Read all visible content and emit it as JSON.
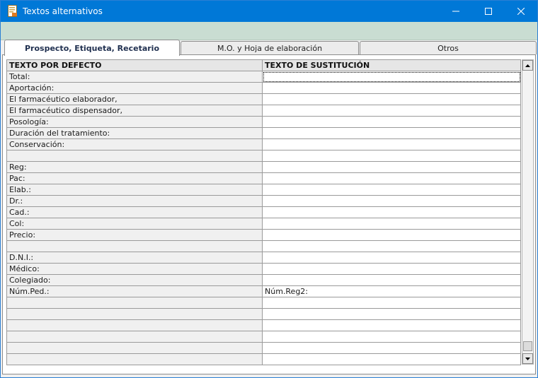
{
  "window": {
    "title": "Textos alternativos"
  },
  "tabs": [
    {
      "label": "Prospecto, Etiqueta, Recetario",
      "active": true
    },
    {
      "label": "M.O. y Hoja de elaboración",
      "active": false
    },
    {
      "label": "Otros",
      "active": false
    }
  ],
  "grid": {
    "headers": [
      "TEXTO POR DEFECTO",
      "TEXTO DE SUSTITUCIÓN"
    ],
    "rows": [
      [
        "Total:",
        ""
      ],
      [
        "Aportación:",
        ""
      ],
      [
        "El farmacéutico elaborador,",
        ""
      ],
      [
        "El farmacéutico dispensador,",
        ""
      ],
      [
        "Posología:",
        ""
      ],
      [
        "Duración del tratamiento:",
        ""
      ],
      [
        "Conservación:",
        ""
      ],
      [
        "",
        ""
      ],
      [
        "Reg:",
        ""
      ],
      [
        "Pac:",
        ""
      ],
      [
        "Elab.:",
        ""
      ],
      [
        "Dr.:",
        ""
      ],
      [
        "Cad.:",
        ""
      ],
      [
        "Col:",
        ""
      ],
      [
        "Precio:",
        ""
      ],
      [
        "",
        ""
      ],
      [
        "D.N.I.:",
        ""
      ],
      [
        "Médico:",
        ""
      ],
      [
        "Colegiado:",
        ""
      ],
      [
        "Núm.Ped.:",
        "Núm.Reg2:"
      ],
      [
        "",
        ""
      ],
      [
        "",
        ""
      ],
      [
        "",
        ""
      ],
      [
        "",
        ""
      ],
      [
        "",
        ""
      ],
      [
        "",
        ""
      ]
    ]
  },
  "icons": {
    "app": "document-icon",
    "minimize": "minimize-icon",
    "maximize": "maximize-icon",
    "close": "close-icon",
    "scroll_up": "arrow-up-icon",
    "scroll_down": "arrow-down-icon"
  },
  "colors": {
    "titlebar": "#0078d7",
    "toolbar": "#c9ddd2",
    "tab_active_text": "#1f2f4f"
  }
}
